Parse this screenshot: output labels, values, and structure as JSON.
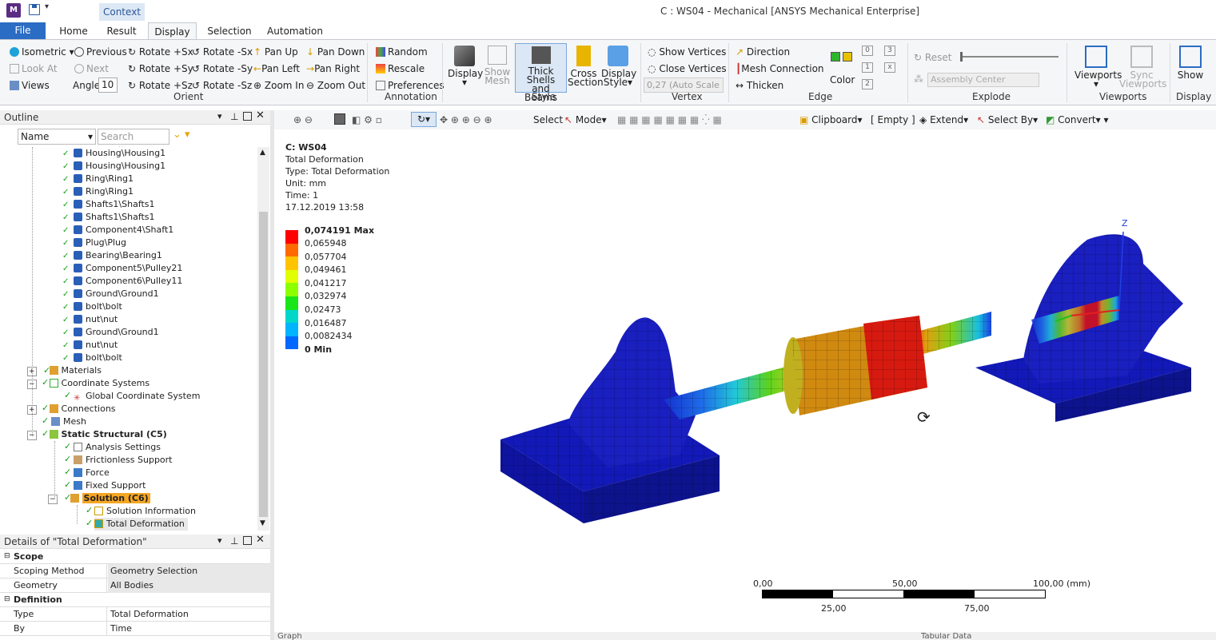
{
  "window": {
    "title": "C : WS04 - Mechanical [ANSYS Mechanical Enterprise]",
    "context_tab": "Context",
    "app_icon": "M"
  },
  "tabs": {
    "file": "File",
    "items": [
      "Home",
      "Result",
      "Display",
      "Selection",
      "Automation"
    ],
    "active": "Display"
  },
  "ribbon": {
    "orient": {
      "label": "Orient",
      "isometric": "Isometric",
      "look_at": "Look At",
      "views": "Views",
      "previous": "Previous",
      "next": "Next",
      "angle_label": "Angle",
      "angle_value": "10",
      "rotate_psx": "Rotate +Sx",
      "rotate_psy": "Rotate +Sy",
      "rotate_psz": "Rotate +Sz",
      "rotate_msx": "Rotate -Sx",
      "rotate_msy": "Rotate -Sy",
      "rotate_msz": "Rotate -Sz",
      "pan_up": "Pan Up",
      "pan_left": "Pan Left",
      "zoom_in": "Zoom In",
      "pan_down": "Pan Down",
      "pan_right": "Pan Right",
      "zoom_out": "Zoom Out"
    },
    "annotation": {
      "label": "Annotation",
      "random": "Random",
      "rescale": "Rescale",
      "preferences": "Preferences"
    },
    "style": {
      "label": "Style",
      "display": "Display",
      "show_mesh_1": "Show",
      "show_mesh_2": "Mesh",
      "thick_1": "Thick Shells",
      "thick_2": "and Beams",
      "cross_1": "Cross",
      "cross_2": "Section",
      "dstyle_1": "Display",
      "dstyle_2": "Style"
    },
    "vertex": {
      "label": "Vertex",
      "show_vertices": "Show Vertices",
      "close_vertices": "Close Vertices",
      "auto_scale": "0,27 (Auto Scale"
    },
    "edge": {
      "label": "Edge",
      "direction": "Direction",
      "mesh_connection": "Mesh Connection",
      "thicken": "Thicken",
      "color": "Color",
      "n0": "0",
      "n1": "1",
      "n2": "2",
      "n3": "3",
      "nx": "x"
    },
    "explode": {
      "label": "Explode",
      "reset": "Reset",
      "assembly_center": "Assembly Center"
    },
    "viewports": {
      "label": "Viewports",
      "viewports": "Viewports",
      "sync_1": "Sync",
      "sync_2": "Viewports"
    },
    "display_grp": {
      "label": "Display",
      "show": "Show"
    }
  },
  "outline": {
    "title": "Outline",
    "name_filter": "Name",
    "search_placeholder": "Search Outline",
    "items": [
      {
        "label": "Housing\\Housing1",
        "status": "x"
      },
      {
        "label": "Housing\\Housing1",
        "status": "x"
      },
      {
        "label": "Ring\\Ring1",
        "status": "x"
      },
      {
        "label": "Ring\\Ring1",
        "status": "x"
      },
      {
        "label": "Shafts1\\Shafts1",
        "status": "x"
      },
      {
        "label": "Shafts1\\Shafts1",
        "status": "x"
      },
      {
        "label": "Component4\\Shaft1",
        "status": "x"
      },
      {
        "label": "Plug\\Plug",
        "status": "x"
      },
      {
        "label": "Bearing\\Bearing1",
        "status": "x"
      },
      {
        "label": "Component5\\Pulley21",
        "status": "x"
      },
      {
        "label": "Component6\\Pulley11",
        "status": "x"
      },
      {
        "label": "Ground\\Ground1",
        "status": "x"
      },
      {
        "label": "bolt\\bolt",
        "status": "x"
      },
      {
        "label": "nut\\nut",
        "status": "x"
      },
      {
        "label": "Ground\\Ground1",
        "status": "x"
      },
      {
        "label": "nut\\nut",
        "status": "x"
      },
      {
        "label": "bolt\\bolt",
        "status": "x"
      }
    ],
    "materials": "Materials",
    "coordinate_systems": "Coordinate Systems",
    "global_cs": "Global Coordinate System",
    "connections": "Connections",
    "mesh": "Mesh",
    "static_structural": "Static Structural (C5)",
    "analysis_settings": "Analysis Settings",
    "frictionless_support": "Frictionless Support",
    "force": "Force",
    "fixed_support": "Fixed Support",
    "solution": "Solution (C6)",
    "solution_information": "Solution Information",
    "total_deformation": "Total Deformation"
  },
  "details": {
    "title": "Details of \"Total Deformation\"",
    "scope": "Scope",
    "scoping_method_k": "Scoping Method",
    "scoping_method_v": "Geometry Selection",
    "geometry_k": "Geometry",
    "geometry_v": "All Bodies",
    "definition": "Definition",
    "type_k": "Type",
    "type_v": "Total Deformation",
    "by_k": "By",
    "by_v": "Time"
  },
  "vp_toolbar": {
    "select": "Select",
    "mode": "Mode",
    "clipboard": "Clipboard",
    "empty": "[ Empty ]",
    "extend": "Extend",
    "select_by": "Select By",
    "convert": "Convert"
  },
  "result": {
    "name": "C: WS04",
    "line1": "Total Deformation",
    "line2": "Type: Total Deformation",
    "line3": "Unit: mm",
    "line4": "Time: 1",
    "line5": "17.12.2019 13:58"
  },
  "legend": {
    "max": "0,074191 Max",
    "values": [
      "0,065948",
      "0,057704",
      "0,049461",
      "0,041217",
      "0,032974",
      "0,02473",
      "0,016487",
      "0,0082434"
    ],
    "min": "0 Min",
    "colors": [
      "#ff0000",
      "#ff6a00",
      "#ffc400",
      "#e1ff00",
      "#8cff00",
      "#19e619",
      "#00d7c8",
      "#00b4ff",
      "#0068ff",
      "#0000ff"
    ]
  },
  "scale": {
    "l0": "0,00",
    "l50": "50,00",
    "l100": "100,00 (mm)",
    "l25": "25,00",
    "l75": "75,00"
  },
  "axis": {
    "z": "Z"
  },
  "bottom": {
    "graph": "Graph",
    "tabular": "Tabular Data"
  }
}
